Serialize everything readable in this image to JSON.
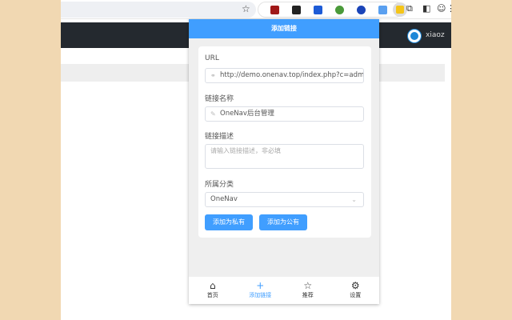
{
  "browser": {
    "user_name": "xiaoz"
  },
  "popup": {
    "title": "添加链接",
    "url": {
      "label": "URL",
      "value": "http://demo.onenav.top/index.php?c=admin&pa"
    },
    "name": {
      "label": "链接名称",
      "value": "OneNav后台管理"
    },
    "desc": {
      "label": "链接描述",
      "placeholder": "请输入链接描述，非必填"
    },
    "category": {
      "label": "所属分类",
      "value": "OneNav"
    },
    "buttons": {
      "private": "添加为私有",
      "public": "添加为公有"
    },
    "nav": [
      {
        "label": "首页"
      },
      {
        "label": "添加链接"
      },
      {
        "label": "推荐"
      },
      {
        "label": "设置"
      }
    ]
  },
  "colors": {
    "accent": "#409eff",
    "background": "#f1d8b2"
  }
}
